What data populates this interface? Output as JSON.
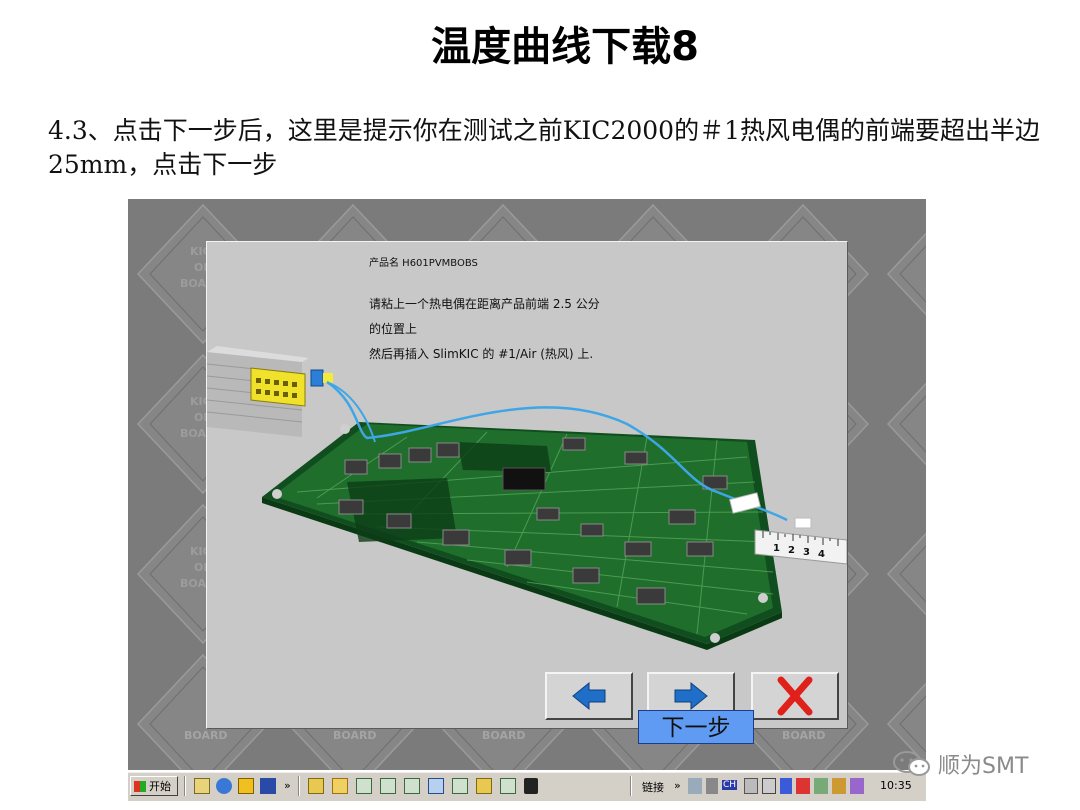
{
  "slide": {
    "title": "温度曲线下载8",
    "description": "4.3、点击下一步后，这里是提示你在测试之前KIC2000的＃1热风电偶的前端要超出半边25mm，点击下一步"
  },
  "background_logo_text": [
    "KIC",
    "ON",
    "BOARD"
  ],
  "dialog": {
    "product_label": "产品名 H601PVMBOBS",
    "instruction_line1": "请粘上一个热电偶在距离产品前端 2.5 公分",
    "instruction_line2": "的位置上",
    "instruction_line3": "然后再插入 SlimKIC 的 #1/Air (热风) 上.",
    "ruler_numbers": [
      "1",
      "2",
      "3",
      "4"
    ],
    "buttons": {
      "back": "back-arrow-icon",
      "next": "next-arrow-icon",
      "cancel": "cancel-x-icon"
    }
  },
  "tooltip": "下一步",
  "taskbar": {
    "start_label": "开始",
    "more_glyph": "»",
    "links_label": "链接",
    "clock": "10:35",
    "ime": "CH"
  },
  "watermark": "顺为SMT",
  "colors": {
    "accent_blue": "#1f6fc9",
    "cancel_red": "#e0201a",
    "pcb_green": "#1f6e2c",
    "tooltip_bg": "#5f9bf2"
  }
}
